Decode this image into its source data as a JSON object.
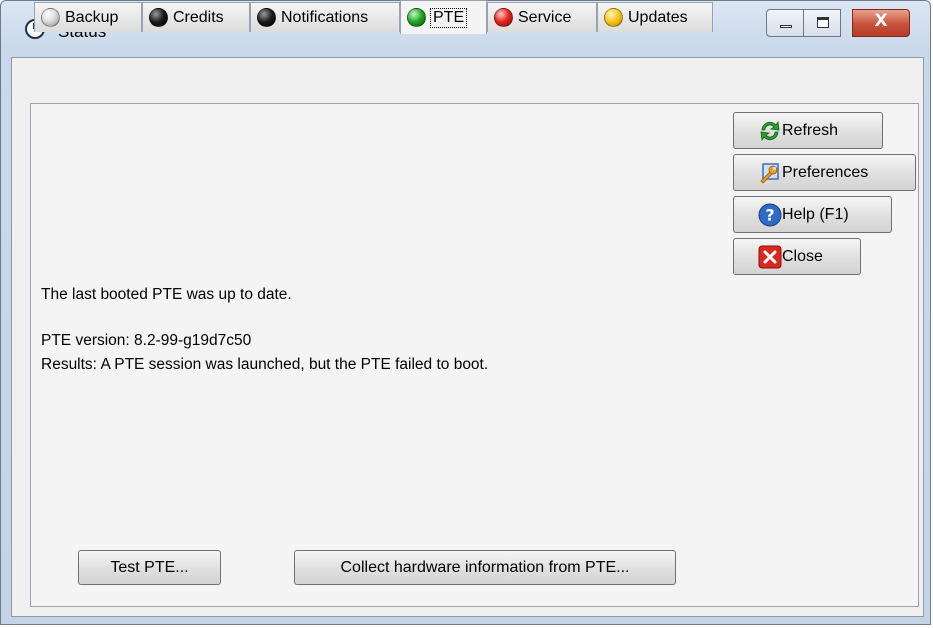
{
  "window": {
    "title": "Status",
    "close_glyph": "X",
    "icon": "status-app-icon"
  },
  "tabs": [
    {
      "label": "Backup",
      "dot_color": "#dcdcdc",
      "active": false
    },
    {
      "label": "Credits",
      "dot_color": "#1a1a1a",
      "active": false
    },
    {
      "label": "Notifications",
      "dot_color": "#1a1a1a",
      "active": false
    },
    {
      "label": "PTE",
      "dot_color": "#1fa21f",
      "active": true
    },
    {
      "label": "Service",
      "dot_color": "#e0221b",
      "active": false
    },
    {
      "label": "Updates",
      "dot_color": "#f5c518",
      "active": false
    }
  ],
  "side_buttons": {
    "refresh": {
      "label": "Refresh",
      "icon": "refresh-icon"
    },
    "preferences": {
      "label": "Preferences",
      "icon": "wrench-icon"
    },
    "help": {
      "label": "Help (F1)",
      "icon": "help-icon"
    },
    "close": {
      "label": "Close",
      "icon": "close-icon"
    }
  },
  "status": {
    "line1": "The last booted PTE was up to date.",
    "version": "PTE version: 8.2-99-g19d7c50",
    "results": "Results: A PTE session was launched, but the PTE failed to boot."
  },
  "bottom_buttons": {
    "test": "Test PTE...",
    "collect": "Collect hardware information from PTE..."
  },
  "colors": {
    "accent_green": "#1fa21f",
    "accent_red": "#e0221b",
    "accent_yellow": "#f5c518"
  }
}
